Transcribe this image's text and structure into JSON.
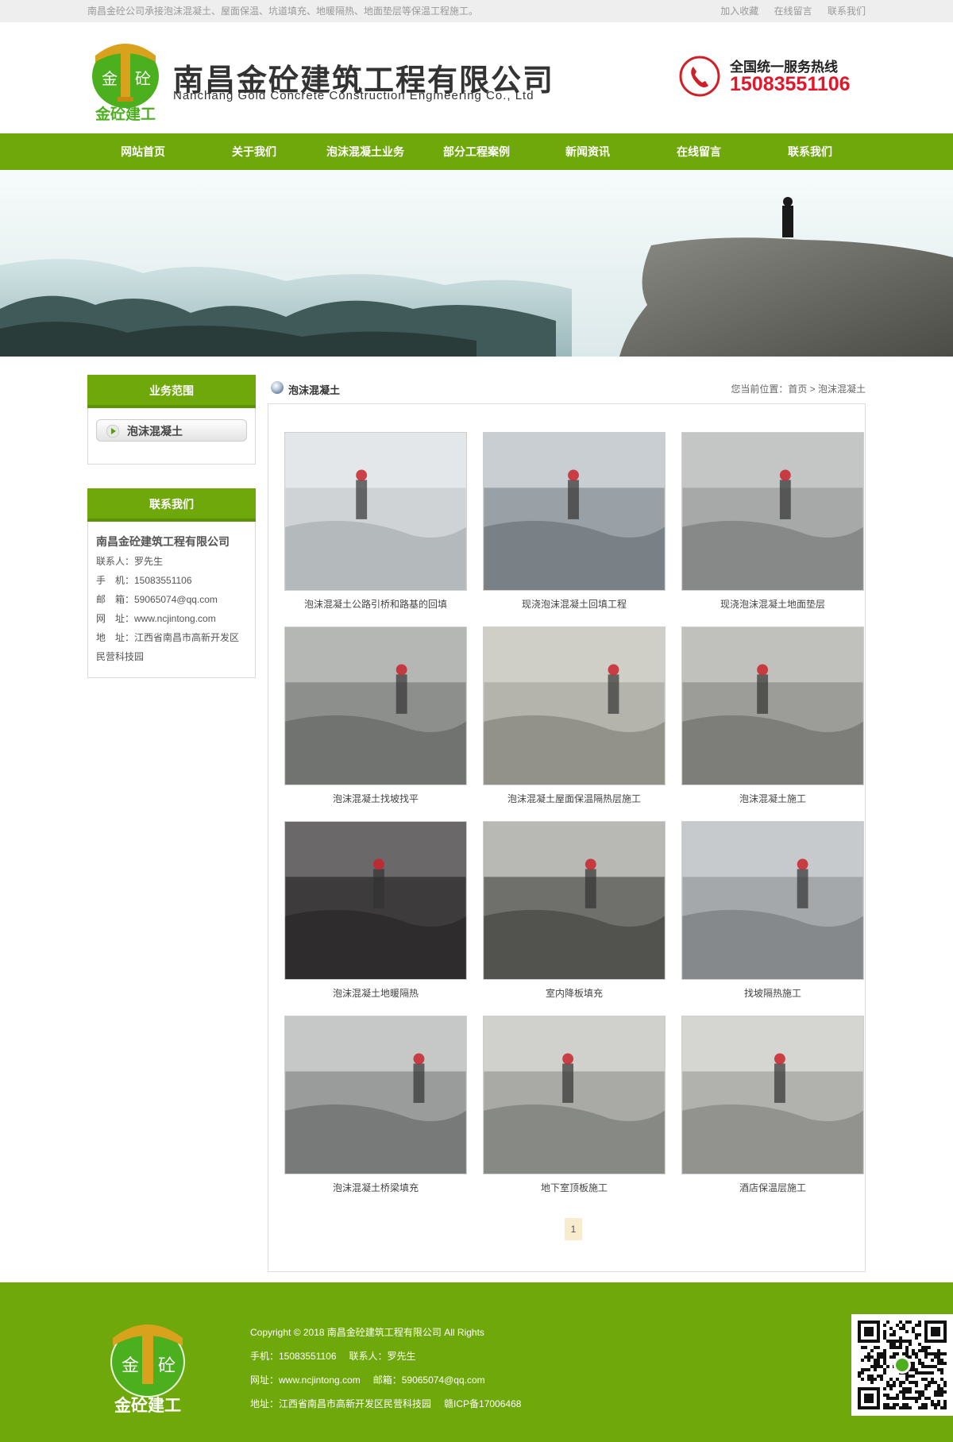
{
  "topbar": {
    "tagline": "南昌金砼公司承接泡沫混凝土、屋面保温、坑道填充、地暖隔热、地面垫层等保温工程施工。",
    "links": [
      "加入收藏",
      "在线留言",
      "联系我们"
    ]
  },
  "header": {
    "logo_top_left": "金",
    "logo_top_right": "砼",
    "logo_text": "金砼建工",
    "company_name": "南昌金砼建筑工程有限公司",
    "company_name_en": "Nanchang Gold Concrete Construction Engineering Co., Ltd",
    "hotline_label": "全国统一服务热线",
    "hotline_number": "15083551106"
  },
  "nav": {
    "items": [
      "网站首页",
      "关于我们",
      "泡沫混凝土业务",
      "部分工程案例",
      "新闻资讯",
      "在线留言",
      "联系我们"
    ]
  },
  "sidebar": {
    "business_title": "业务范围",
    "category": "泡沫混凝土",
    "contact_title": "联系我们",
    "company": "南昌金砼建筑工程有限公司",
    "contact_person": "联系人：罗先生",
    "mobile": "手　机：15083551106",
    "email": "邮　箱：59065074@qq.com",
    "website": "网　址：www.ncjintong.com",
    "address_1": "地　址：江西省南昌市高新开发区",
    "address_2": "民营科技园"
  },
  "content": {
    "section_title": "泡沫混凝土",
    "breadcrumb": "您当前位置：首页 > 泡沫混凝土",
    "items": [
      {
        "caption": "泡沫混凝土公路引桥和路基的回填"
      },
      {
        "caption": "现浇泡沫混凝土回填工程"
      },
      {
        "caption": "现浇泡沫混凝土地面垫层"
      },
      {
        "caption": "泡沫混凝土找坡找平"
      },
      {
        "caption": "泡沫混凝土屋面保温隔热层施工"
      },
      {
        "caption": "泡沫混凝土施工"
      },
      {
        "caption": "泡沫混凝土地暖隔热"
      },
      {
        "caption": "室内降板填充"
      },
      {
        "caption": "找坡隔热施工"
      },
      {
        "caption": "泡沫混凝土桥梁填充"
      },
      {
        "caption": "地下室顶板施工"
      },
      {
        "caption": "酒店保温层施工"
      }
    ],
    "page": "1"
  },
  "footer": {
    "copyright": "Copyright © 2018 南昌金砼建筑工程有限公司 All Rights",
    "mobile": "手机：15083551106",
    "contact": "联系人：罗先生",
    "website": "网址：www.ncjintong.com",
    "email": "邮箱：59065074@qq.com",
    "address": "地址：江西省南昌市高新开发区民营科技园",
    "icp": "赣ICP备17006468"
  },
  "colors": {
    "brand_green": "#6fa80b",
    "hotline_red": "#e0182b",
    "logo_gold": "#d9a21c"
  }
}
